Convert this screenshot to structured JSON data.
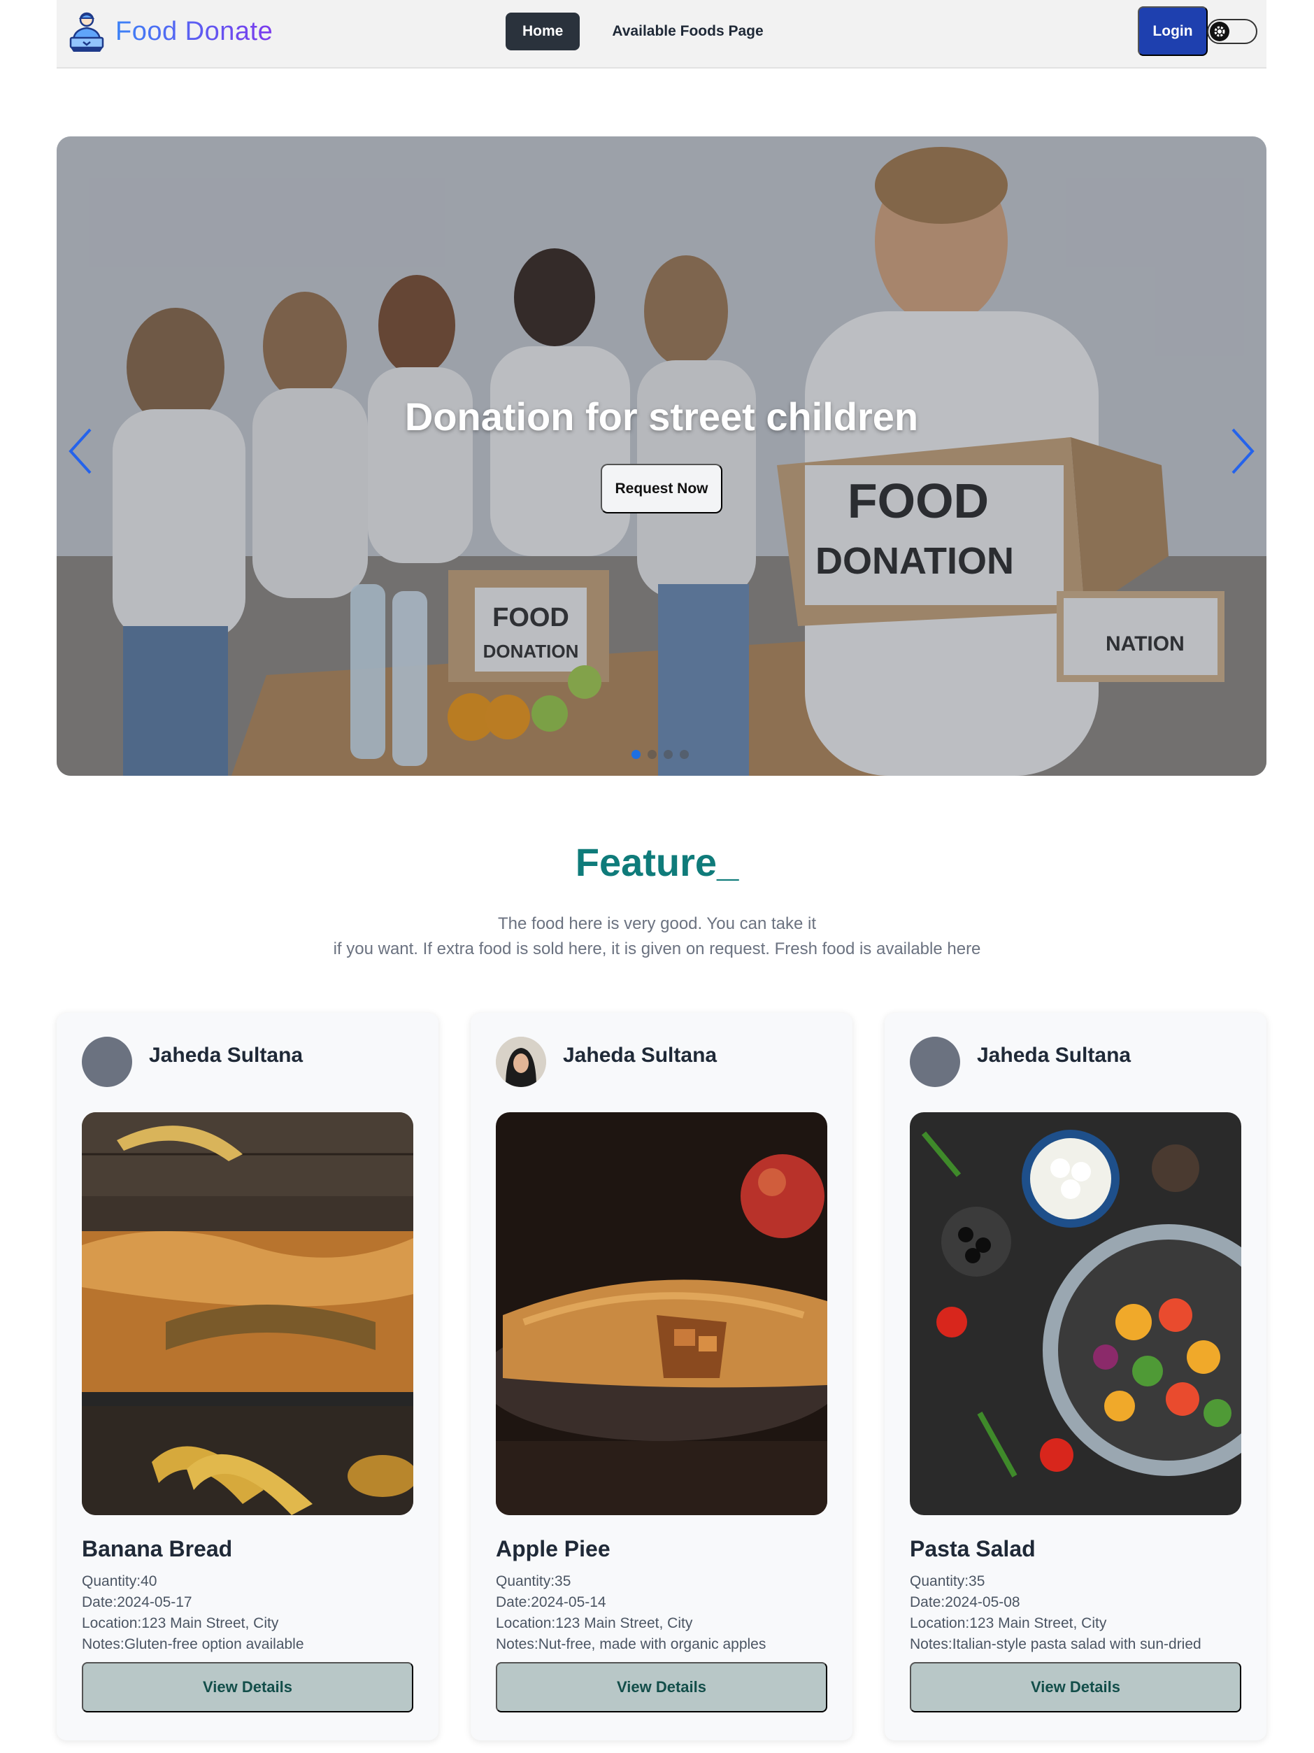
{
  "navbar": {
    "brand": "Food Donate",
    "home_label": "Home",
    "available_label": "Available Foods Page",
    "login_label": "Login",
    "brand_icon": "donor-person-icon",
    "theme_icon": "gear-icon"
  },
  "hero": {
    "title": "Donation for street children",
    "button_label": "Request Now",
    "box_large_line1": "FOOD",
    "box_large_line2": "DONATION",
    "box_small_line1": "FOOD",
    "box_small_line2": "DONATION",
    "box_right": "NATION",
    "slide_count": 4,
    "active_slide": 1
  },
  "feature": {
    "title": "Feature_",
    "desc_line1": "The food here is very good. You can take it",
    "desc_line2": "if you want. If extra food is sold here, it is given on request. Fresh food is available here"
  },
  "cards": [
    {
      "author": "Jaheda Sultana",
      "name": "Banana Bread",
      "quantity": "Quantity:40",
      "date": "Date:2024-05-17",
      "location": "Location:123 Main Street, City",
      "notes": "Notes:Gluten-free option available",
      "button": "View Details"
    },
    {
      "author": "Jaheda Sultana",
      "name": "Apple Piee",
      "quantity": "Quantity:35",
      "date": "Date:2024-05-14",
      "location": "Location:123 Main Street, City",
      "notes": "Notes:Nut-free, made with organic apples",
      "button": "View Details"
    },
    {
      "author": "Jaheda Sultana",
      "name": "Pasta Salad",
      "quantity": "Quantity:35",
      "date": "Date:2024-05-08",
      "location": "Location:123 Main Street, City",
      "notes": "Notes:Italian-style pasta salad with sun-dried",
      "button": "View Details"
    }
  ],
  "colors": {
    "brand_start": "#3b82f6",
    "brand_end": "#7c3aed",
    "login": "#1e40af",
    "feature_title": "#0f7b7a",
    "view_button": "#b8c7c7",
    "active_dot": "#1d6fe0"
  }
}
